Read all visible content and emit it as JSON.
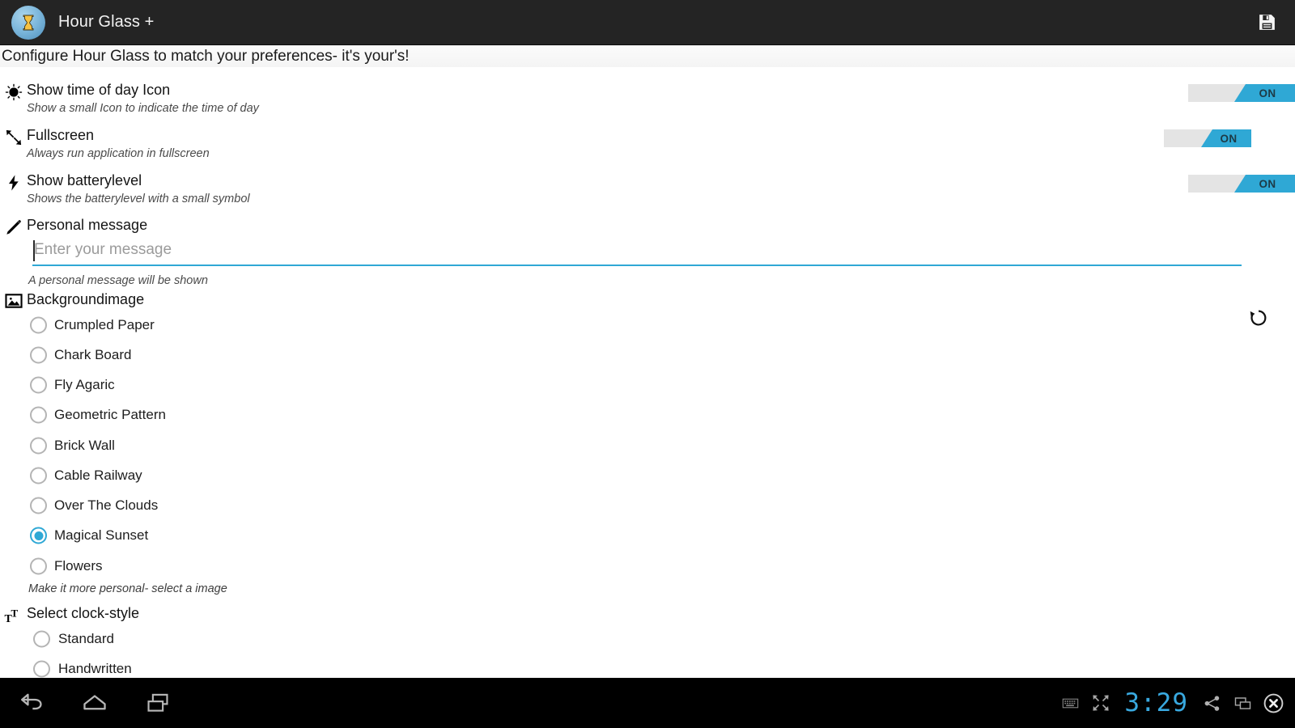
{
  "app": {
    "title": "Hour Glass +",
    "icon": "hourglass-icon",
    "save_icon": "save-floppy-icon",
    "subtitle": "Configure Hour Glass to match your preferences- it's your's!"
  },
  "colors": {
    "accent": "#2fa8d5",
    "toggle_track": "#e4e4e4",
    "action_bar": "#242424",
    "nav_bar": "#000000",
    "clock": "#39a9e0"
  },
  "preferences": [
    {
      "icon": "brightness-sun-icon",
      "title": "Show time of day Icon",
      "summary": "Show a small Icon to indicate the time of day",
      "toggle_state": "ON"
    },
    {
      "icon": "fullscreen-arrows-icon",
      "title": "Fullscreen",
      "summary": "Always run application in fullscreen",
      "toggle_state": "ON"
    },
    {
      "icon": "lightning-bolt-icon",
      "title": "Show batterylevel",
      "summary": "Shows the batterylevel with a small symbol",
      "toggle_state": "ON"
    }
  ],
  "personal_message": {
    "icon": "pencil-icon",
    "title": "Personal message",
    "value": "",
    "placeholder": "Enter your message",
    "summary": "A personal message will be shown",
    "reset_icon": "reset-undo-icon"
  },
  "background_image": {
    "icon": "picture-image-icon",
    "title": "Backgroundimage",
    "footer": "Make it more personal- select a image",
    "selected": "Magical Sunset",
    "options": [
      "Crumpled Paper",
      "Chark Board",
      "Fly Agaric",
      "Geometric Pattern",
      "Brick Wall",
      "Cable Railway",
      "Over The Clouds",
      "Magical Sunset",
      "Flowers"
    ]
  },
  "clock_style": {
    "icon": "text-size-icon",
    "title": "Select clock-style",
    "selected": "",
    "options": [
      "Standard",
      "Handwritten"
    ]
  },
  "nav_bar": {
    "back_icon": "back-arrow-icon",
    "home_icon": "home-icon",
    "recents_icon": "recent-apps-icon",
    "keyboard_icon": "keyboard-icon",
    "expand_icon": "expand-fullscreen-icon",
    "clock": "3:29",
    "share_icon": "share-icon",
    "window_icon": "window-resize-icon",
    "close_icon": "close-circle-icon"
  }
}
